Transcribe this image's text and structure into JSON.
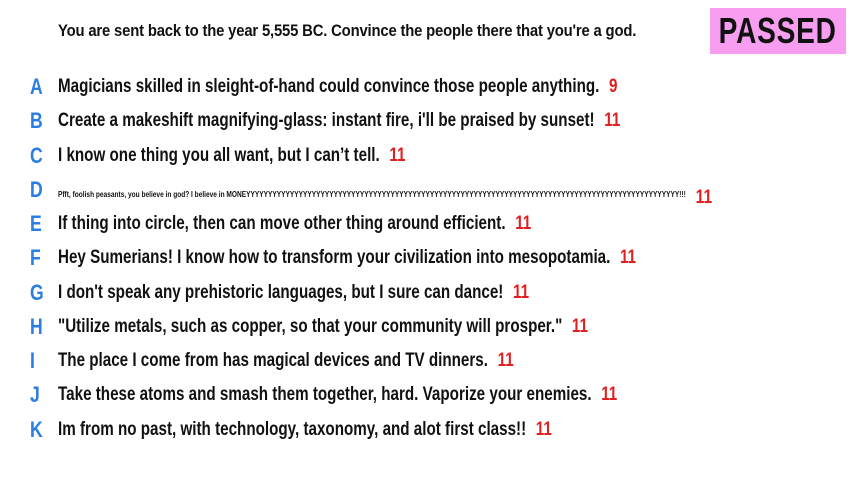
{
  "prompt": "You are sent back to the year 5,555 BC. Convince the people there that you're a god.",
  "status_badge": "PASSED",
  "colors": {
    "letter": "#2a7de1",
    "score": "#e02020",
    "badge_bg": "#f79ef0"
  },
  "answers": [
    {
      "letter": "A",
      "text": "Magicians skilled in sleight-of-hand could convince those people anything.",
      "score": "9"
    },
    {
      "letter": "B",
      "text": "Create a makeshift magnifying-glass: instant fire, i'll be praised by sunset!",
      "score": "11"
    },
    {
      "letter": "C",
      "text": "I know one thing you all want, but I can’t tell.",
      "score": "11"
    },
    {
      "letter": "D",
      "text": "Pfft, foolish peasants, you believe in god? I believe in MONEYYYYYYYYYYYYYYYYYYYYYYYYYYYYYYYYYYYYYYYYYYYYYYYYYYYYYYYYYYYYYYYYYYYYYYYYYYYYYYYYYYYYYYYYYYYYYYYYYYY!!!",
      "score": "11"
    },
    {
      "letter": "E",
      "text": "If thing into circle, then can move other thing around efficient.",
      "score": "11"
    },
    {
      "letter": "F",
      "text": "Hey Sumerians! I know how to transform your civilization into mesopotamia.",
      "score": "11"
    },
    {
      "letter": "G",
      "text": "I don't speak any prehistoric languages, but I sure can dance!",
      "score": "11"
    },
    {
      "letter": "H",
      "text": "\"Utilize metals, such as copper, so that your community will prosper.\"",
      "score": "11"
    },
    {
      "letter": "I",
      "text": "The place I come from has magical devices and TV dinners.",
      "score": "11"
    },
    {
      "letter": "J",
      "text": "Take these atoms and smash them together, hard. Vaporize your enemies.",
      "score": "11"
    },
    {
      "letter": "K",
      "text": "Im from no past, with technology, taxonomy, and alot first class!!",
      "score": "11"
    }
  ]
}
